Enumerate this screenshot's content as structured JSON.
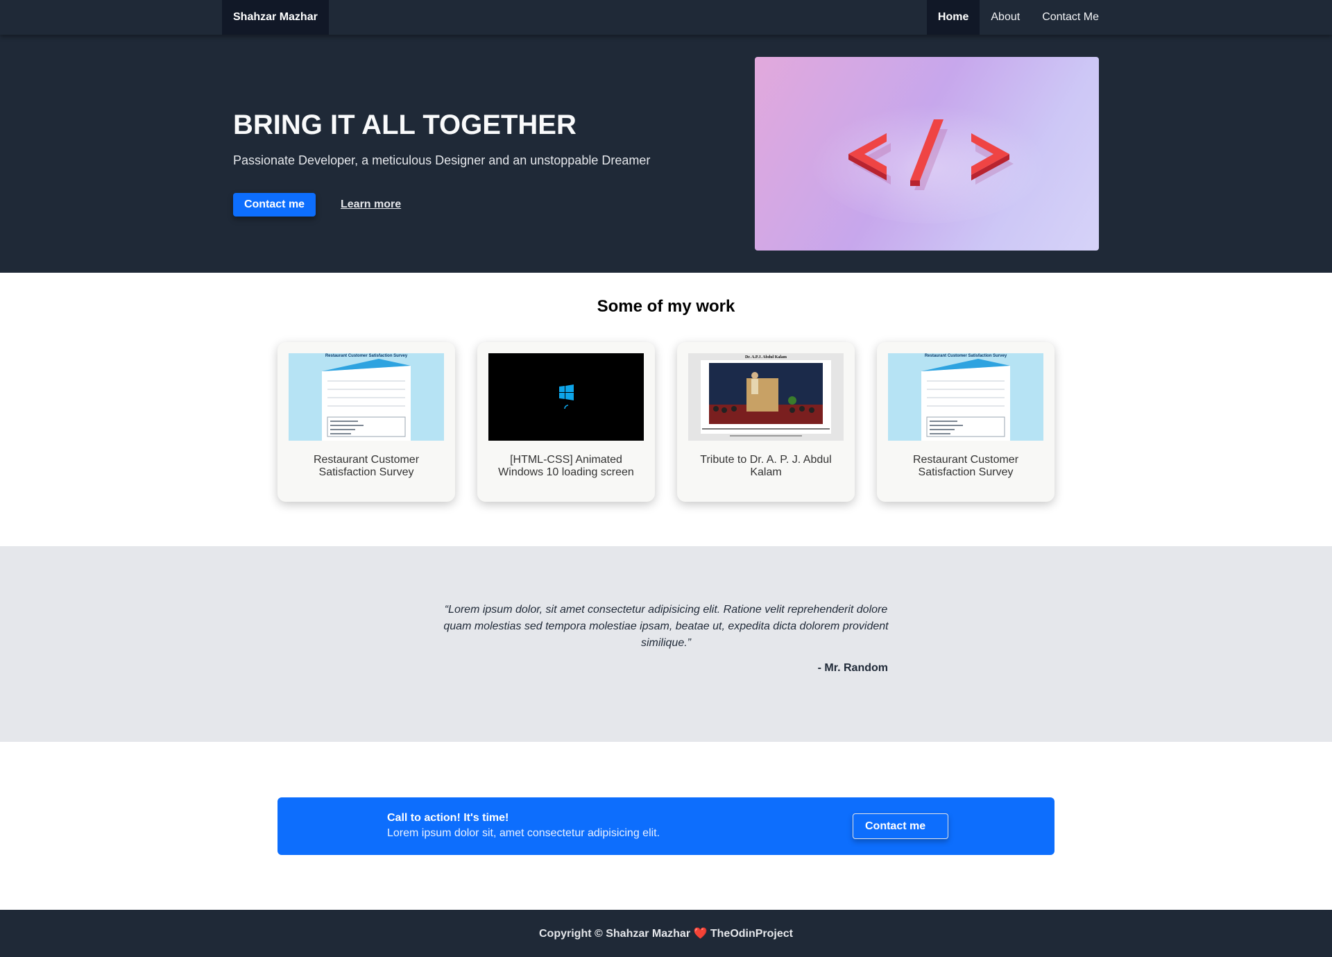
{
  "nav": {
    "brand": "Shahzar Mazhar",
    "links": [
      {
        "label": "Home",
        "active": true
      },
      {
        "label": "About",
        "active": false
      },
      {
        "label": "Contact Me",
        "active": false
      }
    ]
  },
  "hero": {
    "title": "BRING IT ALL TOGETHER",
    "subtitle": "Passionate Developer, a meticulous Designer and an unstoppable Dreamer",
    "primary_button": "Contact me",
    "secondary_link": "Learn more",
    "image_icon": "code-tag-icon"
  },
  "work": {
    "title": "Some of my work",
    "cards": [
      {
        "label": "Restaurant Customer Satisfaction Survey",
        "thumb_title": "Restaurant Customer Satisfaction Survey"
      },
      {
        "label": "[HTML-CSS] Animated Windows 10 loading screen",
        "thumb_icon": "windows-logo-icon"
      },
      {
        "label": "Tribute to Dr. A. P. J. Abdul Kalam",
        "thumb_title": "Dr. A.P.J. Abdul Kalam"
      },
      {
        "label": "Restaurant Customer Satisfaction Survey",
        "thumb_title": "Restaurant Customer Satisfaction Survey"
      }
    ]
  },
  "quote": {
    "text": "“Lorem ipsum dolor, sit amet consectetur adipisicing elit. Ratione velit reprehenderit dolore quam molestias sed tempora molestiae ipsam, beatae ut, expedita dicta dolorem provident similique.”",
    "author": "- Mr. Random"
  },
  "cta": {
    "title": "Call to action! It's time!",
    "text": "Lorem ipsum dolor sit, amet consectetur adipisicing elit.",
    "button": "Contact me"
  },
  "footer": {
    "prefix": "Copyright © Shahzar Mazhar",
    "heart": "❤️",
    "suffix": "TheOdinProject"
  },
  "colors": {
    "dark": "#1f2937",
    "darker": "#111827",
    "primary": "#0d6efd",
    "light_gray": "#e5e7eb"
  }
}
